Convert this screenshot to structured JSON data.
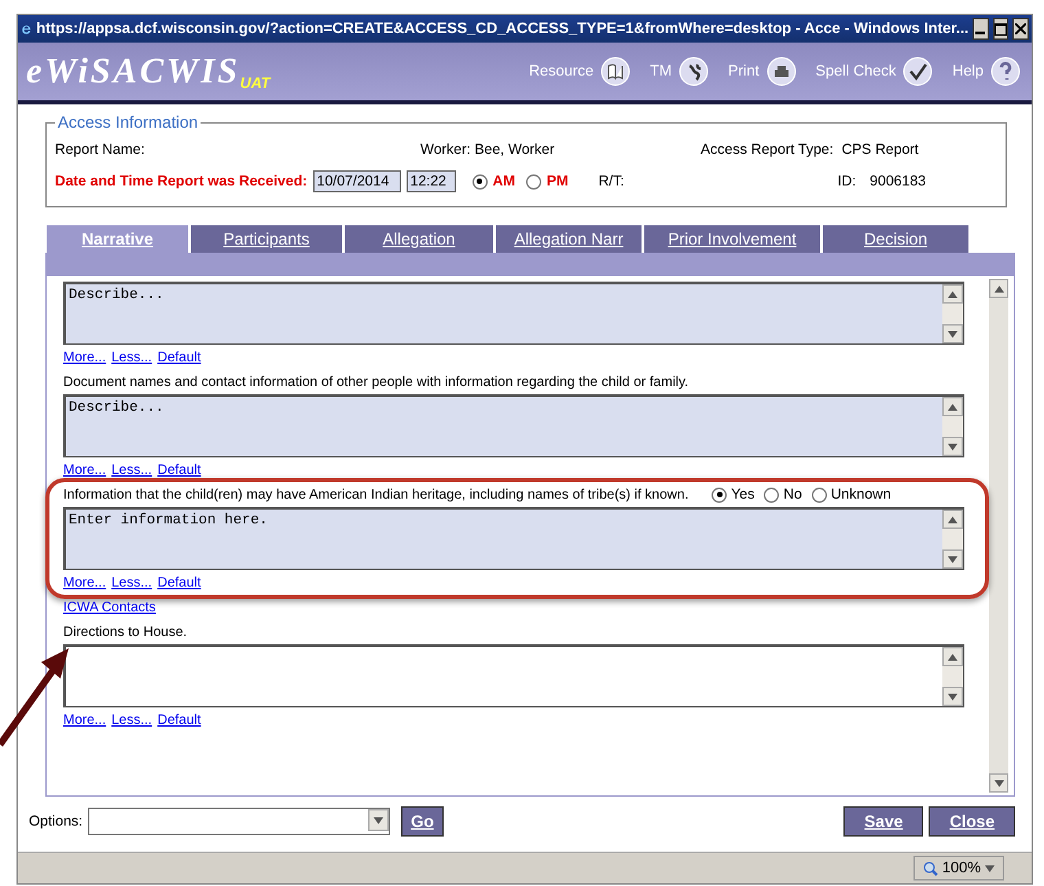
{
  "window": {
    "title": "https://appsa.dcf.wisconsin.gov/?action=CREATE&ACCESS_CD_ACCESS_TYPE=1&fromWhere=desktop - Acce - Windows Inter..."
  },
  "header": {
    "logo": "eWiSACWIS",
    "environment": "UAT",
    "tools": [
      {
        "label": "Resource",
        "kind": "book"
      },
      {
        "label": "TM",
        "kind": "globe"
      },
      {
        "label": "Print",
        "kind": "printer"
      },
      {
        "label": "Spell Check",
        "kind": "spell"
      },
      {
        "label": "Help",
        "kind": "help"
      }
    ]
  },
  "access_info": {
    "legend": "Access Information",
    "report_name_label": "Report Name:",
    "worker": "Worker: Bee, Worker",
    "report_type_label": "Access Report Type:",
    "report_type": "CPS Report",
    "received_label": "Date and Time Report was Received:",
    "date": "10/07/2014",
    "time": "12:22",
    "meridiem": [
      {
        "label": "AM",
        "selected": true
      },
      {
        "label": "PM",
        "selected": false
      }
    ],
    "rt_label": "R/T:",
    "id_label": "ID:",
    "id": "9006183"
  },
  "tabs": [
    {
      "label": "Narrative",
      "selected": true
    },
    {
      "label": "Participants",
      "selected": false
    },
    {
      "label": "Allegation",
      "selected": false
    },
    {
      "label": "Allegation Narr",
      "selected": false
    },
    {
      "label": "Prior Involvement",
      "selected": false
    },
    {
      "label": "Decision",
      "selected": false
    }
  ],
  "sections": [
    {
      "kind": "textarea",
      "value": "Describe...",
      "filled": true,
      "highlighted": false,
      "links": [
        "More...",
        "Less...",
        "Default"
      ]
    },
    {
      "kind": "textarea",
      "prompt": "Document names and contact information of other people with information regarding the child or family.",
      "value": "Describe...",
      "filled": true,
      "highlighted": false,
      "links": [
        "More...",
        "Less...",
        "Default"
      ]
    },
    {
      "kind": "textarea",
      "prompt": "Information that the child(ren) may have American Indian heritage, including names of tribe(s) if known.",
      "options": [
        {
          "label": "Yes",
          "selected": true
        },
        {
          "label": "No",
          "selected": false
        },
        {
          "label": "Unknown",
          "selected": false
        }
      ],
      "value": "Enter information here.",
      "filled": true,
      "highlighted": true,
      "links": [
        "More...",
        "Less...",
        "Default"
      ]
    },
    {
      "kind": "link",
      "label": "ICWA Contacts"
    },
    {
      "kind": "textarea",
      "prompt": "Directions to House.",
      "filled": false,
      "highlighted": false,
      "links": [
        "More...",
        "Less...",
        "Default"
      ]
    }
  ],
  "footer": {
    "options_label": "Options:",
    "go": "Go",
    "save": "Save",
    "close": "Close"
  },
  "status_bar": {
    "zoom": "100%"
  }
}
